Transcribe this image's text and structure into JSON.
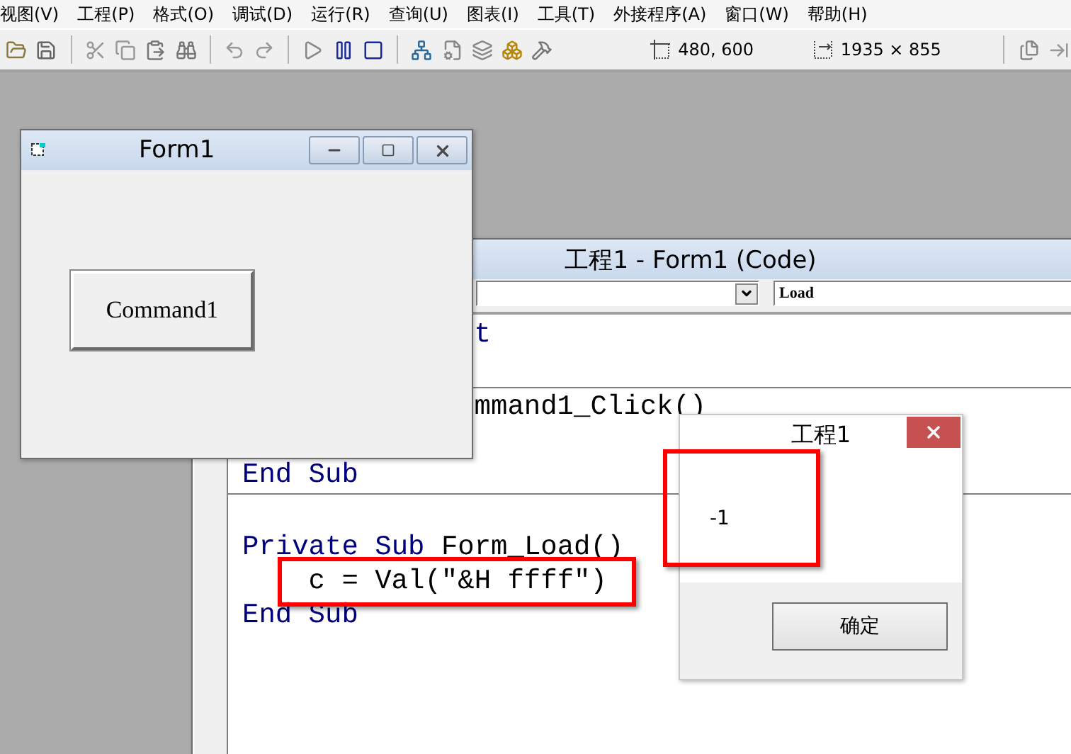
{
  "menu": [
    {
      "label": "视图(V)"
    },
    {
      "label": "工程(P)"
    },
    {
      "label": "格式(O)"
    },
    {
      "label": "调试(D)"
    },
    {
      "label": "运行(R)"
    },
    {
      "label": "查询(U)"
    },
    {
      "label": "图表(I)"
    },
    {
      "label": "工具(T)"
    },
    {
      "label": "外接程序(A)"
    },
    {
      "label": "窗口(W)"
    },
    {
      "label": "帮助(H)"
    }
  ],
  "toolbar": {
    "position": "480, 600",
    "size": "1935 × 855"
  },
  "form_window": {
    "title": "Form1",
    "button": "Command1"
  },
  "code_window": {
    "title": "工程1 - Form1 (Code)",
    "procedure_combo": "Load",
    "lines": [
      {
        "kind": "partial",
        "tokens": [
          {
            "text": "t",
            "keyword": true
          }
        ]
      },
      {
        "kind": "blank"
      },
      {
        "kind": "divider"
      },
      {
        "kind": "partial",
        "tokens": [
          {
            "text": "mmand1_Click()",
            "keyword": false
          }
        ]
      },
      {
        "kind": "blank"
      },
      {
        "kind": "code",
        "tokens": [
          {
            "text": "End Sub",
            "keyword": true
          }
        ]
      },
      {
        "kind": "divider"
      },
      {
        "kind": "blank"
      },
      {
        "kind": "code",
        "tokens": [
          {
            "text": "Private Sub ",
            "keyword": true
          },
          {
            "text": "Form_Load()",
            "keyword": false
          }
        ]
      },
      {
        "kind": "code",
        "indented": true,
        "tokens": [
          {
            "text": "c = Val(\"&H ffff\")",
            "keyword": false
          }
        ]
      },
      {
        "kind": "code",
        "tokens": [
          {
            "text": "End Sub",
            "keyword": true
          }
        ]
      }
    ]
  },
  "dialog": {
    "title": "工程1",
    "message": "-1",
    "button": "确定"
  }
}
